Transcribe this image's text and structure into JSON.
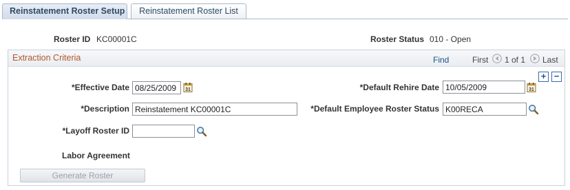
{
  "tabs": {
    "active": "Reinstatement Roster Setup",
    "inactive": "Reinstatement Roster List"
  },
  "header": {
    "roster_id_label": "Roster ID",
    "roster_id_value": "KC00001C",
    "roster_status_label": "Roster Status",
    "roster_status_value": "010 - Open"
  },
  "extraction": {
    "title": "Extraction Criteria",
    "find": "Find",
    "first": "First",
    "count": "1 of 1",
    "last": "Last",
    "add_label": "+",
    "delete_label": "−",
    "effective_date_label": "*Effective Date",
    "effective_date_value": "08/25/2009",
    "default_rehire_date_label": "*Default Rehire Date",
    "default_rehire_date_value": "10/05/2009",
    "description_label": "*Description",
    "description_value": "Reinstatement KC00001C",
    "default_employee_roster_status_label": "*Default Employee Roster Status",
    "default_employee_roster_status_value": "K00RECA",
    "layoff_roster_id_label": "*Layoff Roster ID",
    "layoff_roster_id_value": "",
    "labor_agreement_label": "Labor Agreement",
    "generate_button": "Generate Roster"
  },
  "icons": {
    "calendar": "calendar-icon",
    "lookup": "magnifier-icon",
    "prev": "arrow-left-circle-icon",
    "next": "arrow-right-circle-icon"
  },
  "colors": {
    "group_title": "#b3562a",
    "link": "#1f4f8a",
    "tab_text": "#2e4a66"
  }
}
